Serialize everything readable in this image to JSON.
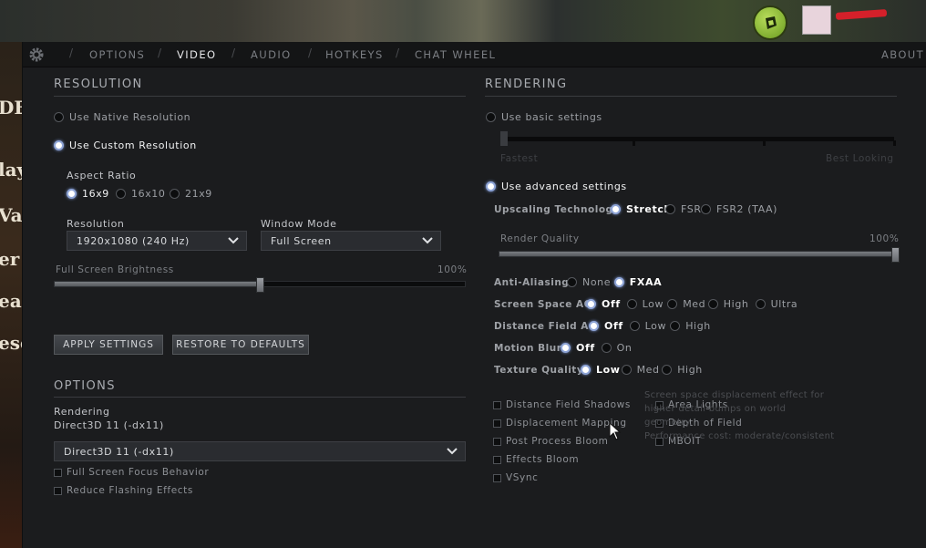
{
  "nav": {
    "tabs": [
      {
        "label": "OPTIONS"
      },
      {
        "label": "VIDEO"
      },
      {
        "label": "AUDIO"
      },
      {
        "label": "HOTKEYS"
      },
      {
        "label": "CHAT WHEEL"
      }
    ],
    "active_tab": "VIDEO",
    "about_label": "ABOUT"
  },
  "resolution": {
    "title": "RESOLUTION",
    "native_label": "Use Native Resolution",
    "custom_label": "Use Custom Resolution",
    "aspect_ratio_label": "Aspect Ratio",
    "aspect_options": [
      "16x9",
      "16x10",
      "21x9"
    ],
    "aspect_selected": "16x9",
    "resolution_label": "Resolution",
    "resolution_value": "1920x1080 (240 Hz)",
    "window_mode_label": "Window Mode",
    "window_mode_value": "Full Screen",
    "brightness_label": "Full Screen Brightness",
    "brightness_value_label": "100%",
    "brightness_level": 0.5,
    "apply_label": "APPLY SETTINGS",
    "restore_label": "RESTORE TO DEFAULTS"
  },
  "options": {
    "title": "OPTIONS",
    "rendering_label": "Rendering",
    "rendering_value": "Direct3D 11 (-dx11)",
    "renderer_dropdown_value": "Direct3D 11 (-dx11)",
    "checkboxes": [
      {
        "label": "Full Screen Focus Behavior"
      },
      {
        "label": "Reduce Flashing Effects"
      }
    ]
  },
  "rendering": {
    "title": "RENDERING",
    "basic_label": "Use basic settings",
    "basic_left": "Fastest",
    "basic_right": "Best Looking",
    "advanced_label": "Use advanced settings",
    "upscaling_label": "Upscaling Technology",
    "upscaling_options": [
      "Stretch",
      "FSR",
      "FSR2 (TAA)"
    ],
    "upscaling_selected": "Stretch",
    "render_quality_label": "Render Quality",
    "render_quality_value": "100%",
    "render_quality_level": 1.0,
    "rows": [
      {
        "label": "Anti-Aliasing",
        "options": [
          "None",
          "FXAA"
        ],
        "selected": "FXAA"
      },
      {
        "label": "Screen Space AO",
        "options": [
          "Off",
          "Low",
          "Med",
          "High",
          "Ultra"
        ],
        "selected": "Off"
      },
      {
        "label": "Distance Field AO",
        "options": [
          "Off",
          "Low",
          "High"
        ],
        "selected": "Off"
      },
      {
        "label": "Motion Blur",
        "options": [
          "Off",
          "On"
        ],
        "selected": "Off"
      },
      {
        "label": "Texture Quality",
        "options": [
          "Low",
          "Med",
          "High"
        ],
        "selected": "Low"
      }
    ],
    "checks_left": [
      {
        "label": "Distance Field Shadows"
      },
      {
        "label": "Displacement Mapping"
      },
      {
        "label": "Post Process Bloom"
      },
      {
        "label": "Effects Bloom"
      },
      {
        "label": "VSync"
      }
    ],
    "checks_right": [
      {
        "label": "Area Lights"
      },
      {
        "label": "Depth of Field"
      },
      {
        "label": "MBOIT"
      }
    ],
    "tooltip_lines": [
      "Screen space displacement effect for",
      "higher detail bumps on world",
      "geometry.",
      "Performance cost: moderate/consistent"
    ]
  },
  "colors": {
    "panel": "#1b1c1e",
    "accent_radio": "#8ea4d6",
    "coin": "#8fbf2e"
  }
}
